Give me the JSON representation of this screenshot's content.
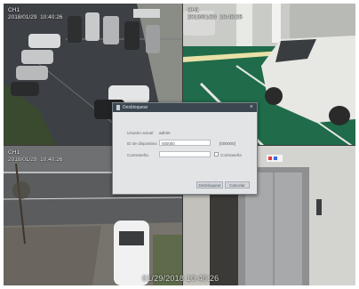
{
  "cameras": [
    {
      "channel": "CH1",
      "timestamp": "2018/01/29  10:40:26"
    },
    {
      "channel": "CH1",
      "timestamp": "2018/01/29  10:40:26"
    },
    {
      "channel": "CH1",
      "timestamp": "2018/01/29  10:40:26"
    },
    {
      "channel": "",
      "timestamp": ""
    }
  ],
  "bottom_timestamp": "01/29/2018 10:40:26",
  "dialog": {
    "title": "Desbloquear",
    "close_icon": "close-icon",
    "user_label": "Usuario actual",
    "user_value": "admin",
    "device_id_label": "ID de dispositivo",
    "device_id_value": "000000",
    "device_id_hint": "[000000]",
    "password_label": "Contraseña",
    "password_value": "",
    "show_password_label": "Contraseña",
    "unlock_button": "Desbloquear",
    "cancel_button": "Cancelar"
  },
  "colors": {
    "dialog_bg": "#e2e4e6",
    "title_bar": "#3c4650",
    "lot_floor": "#3a3d42",
    "garage_floor": "#1f6b4a"
  }
}
